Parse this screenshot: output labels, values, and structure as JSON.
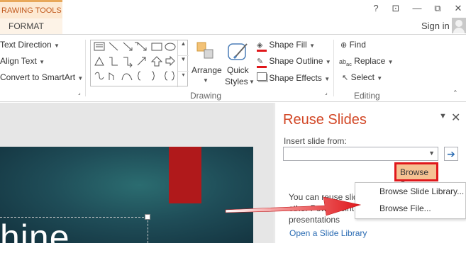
{
  "tabs": {
    "context_group": "RAWING TOOLS",
    "format": "FORMAT"
  },
  "window": {
    "help": "?",
    "ribbon_display": "⊡",
    "minimize": "—",
    "restore": "⧉",
    "close": "✕",
    "sign_in": "Sign in"
  },
  "ribbon": {
    "paragraph": {
      "text_direction": "Text Direction",
      "align_text": "Align Text",
      "convert_smartart": "Convert to SmartArt"
    },
    "drawing": {
      "label": "Drawing",
      "arrange": "Arrange",
      "quick_styles_1": "Quick",
      "quick_styles_2": "Styles",
      "shape_fill": "Shape Fill",
      "shape_outline": "Shape Outline",
      "shape_effects": "Shape Effects"
    },
    "editing": {
      "label": "Editing",
      "find": "Find",
      "replace": "Replace",
      "select": "Select"
    }
  },
  "slide": {
    "text": "hine"
  },
  "pane": {
    "title": "Reuse Slides",
    "menu": "▼",
    "close": "✕",
    "insert_from": "Insert slide from:",
    "insert_value": "",
    "go": "➔",
    "browse": "Browse",
    "body_line1": "You can reuse slid",
    "body_line2": "other PowerPoint",
    "body_line3": "presentations",
    "open_library": "Open a Slide Library"
  },
  "dropdown": {
    "items": [
      "Browse Slide Library...",
      "Browse File..."
    ]
  },
  "colors": {
    "accent": "#d24726",
    "highlight_border": "#e0171b",
    "arrow": "#e0171b",
    "link": "#2b6cb3"
  }
}
